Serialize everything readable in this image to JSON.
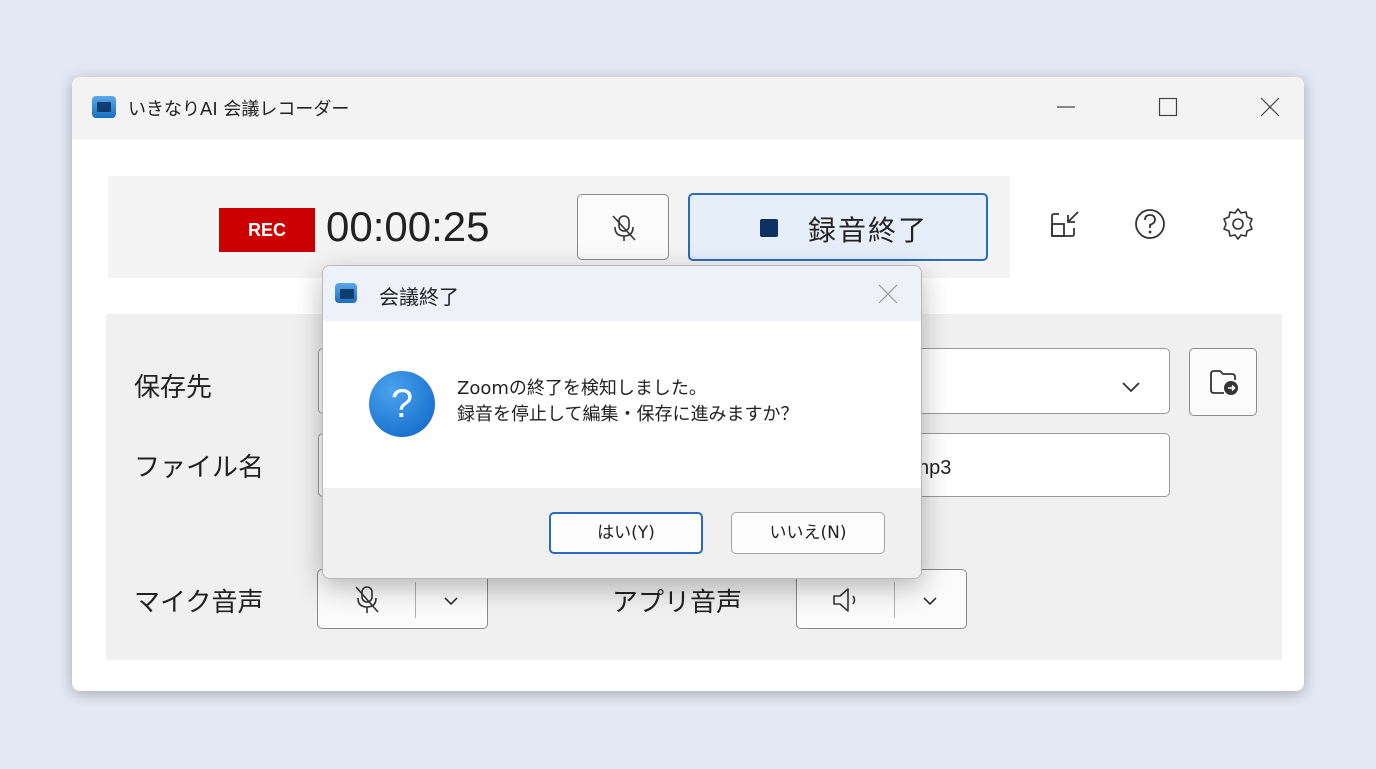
{
  "window": {
    "title": "いきなりAI 会議レコーダー"
  },
  "recorder": {
    "rec_badge": "REC",
    "elapsed": "00:00:25",
    "stop_label": "録音終了"
  },
  "settings": {
    "save_label": "保存先",
    "file_label": "ファイル名",
    "file_value_visible": "np3",
    "mic_label": "マイク音声",
    "app_label": "アプリ音声"
  },
  "dialog": {
    "title": "会議終了",
    "message_line1": "Zoomの終了を検知しました。",
    "message_line2": "録音を停止して編集・保存に進みますか？",
    "yes_label": "はい(Y)",
    "no_label": "いいえ(N)"
  },
  "colors": {
    "rec_red": "#cc0000",
    "accent_blue": "#2b6bbd",
    "background": "#e3e9f4"
  },
  "icons": [
    "app-icon",
    "minimize-icon",
    "maximize-icon",
    "close-icon",
    "mic-muted-icon",
    "stop-icon",
    "mini-mode-icon",
    "help-icon",
    "settings-icon",
    "chevron-down-icon",
    "folder-open-icon",
    "speaker-icon",
    "question-icon"
  ]
}
